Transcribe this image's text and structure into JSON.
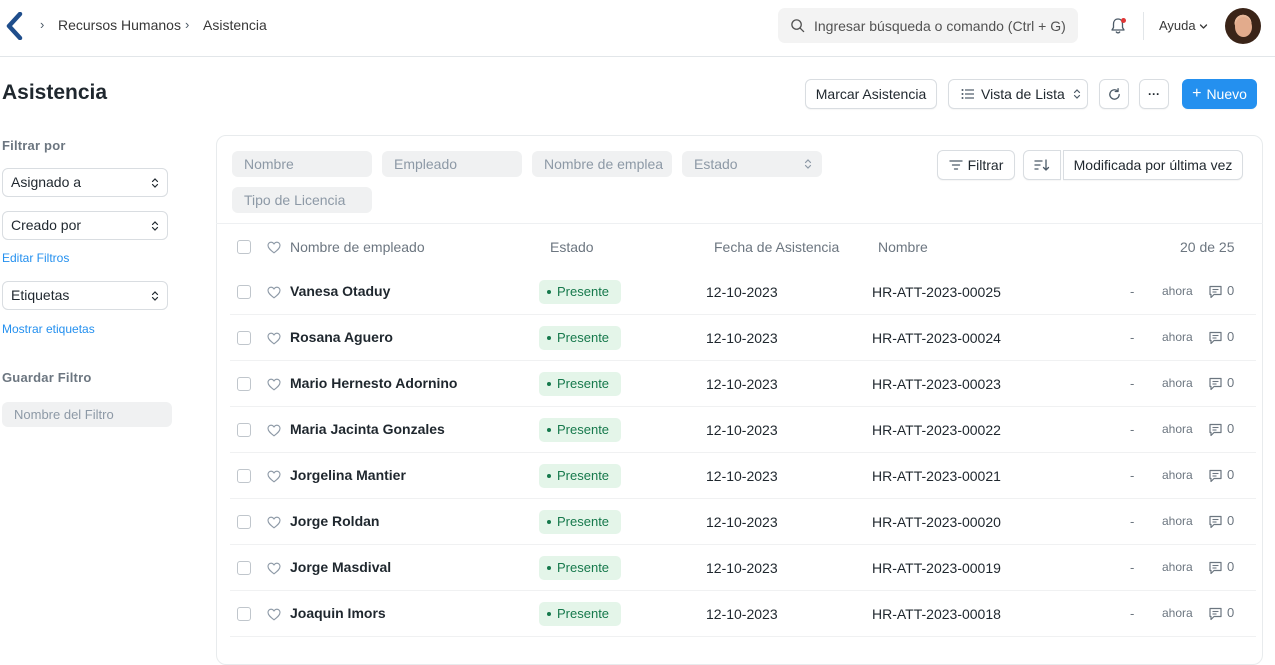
{
  "breadcrumb": {
    "module": "Recursos Humanos",
    "page": "Asistencia"
  },
  "search": {
    "placeholder": "Ingresar búsqueda o comando (Ctrl + G)"
  },
  "navbar": {
    "help_label": "Ayuda"
  },
  "page": {
    "title": "Asistencia"
  },
  "actions": {
    "mark_attendance": "Marcar Asistencia",
    "list_view": "Vista de Lista",
    "new_label": "Nuevo",
    "more": "···"
  },
  "sidebar": {
    "filter_by": "Filtrar por",
    "assigned_to": "Asignado a",
    "created_by": "Creado por",
    "edit_filters": "Editar Filtros",
    "tags": "Etiquetas",
    "show_tags": "Mostrar etiquetas",
    "save_filter": "Guardar Filtro",
    "filter_name_placeholder": "Nombre del Filtro"
  },
  "filters": {
    "name_placeholder": "Nombre",
    "employee_placeholder": "Empleado",
    "employee_name_placeholder": "Nombre de emplea",
    "status_placeholder": "Estado",
    "leave_type_placeholder": "Tipo de Licencia",
    "filter_button": "Filtrar",
    "sort_label": "Modificada por última vez"
  },
  "table": {
    "columns": {
      "employee_name": "Nombre de empleado",
      "status": "Estado",
      "date": "Fecha de Asistencia",
      "name": "Nombre"
    },
    "count": "20 de 25",
    "rows": [
      {
        "employee": "Vanesa Otaduy",
        "status": "Presente",
        "date": "12-10-2023",
        "name": "HR-ATT-2023-00025",
        "dash": "-",
        "modified": "ahora",
        "comments": "0"
      },
      {
        "employee": "Rosana Aguero",
        "status": "Presente",
        "date": "12-10-2023",
        "name": "HR-ATT-2023-00024",
        "dash": "-",
        "modified": "ahora",
        "comments": "0"
      },
      {
        "employee": "Mario Hernesto Adornino",
        "status": "Presente",
        "date": "12-10-2023",
        "name": "HR-ATT-2023-00023",
        "dash": "-",
        "modified": "ahora",
        "comments": "0"
      },
      {
        "employee": "Maria Jacinta Gonzales",
        "status": "Presente",
        "date": "12-10-2023",
        "name": "HR-ATT-2023-00022",
        "dash": "-",
        "modified": "ahora",
        "comments": "0"
      },
      {
        "employee": "Jorgelina Mantier",
        "status": "Presente",
        "date": "12-10-2023",
        "name": "HR-ATT-2023-00021",
        "dash": "-",
        "modified": "ahora",
        "comments": "0"
      },
      {
        "employee": "Jorge Roldan",
        "status": "Presente",
        "date": "12-10-2023",
        "name": "HR-ATT-2023-00020",
        "dash": "-",
        "modified": "ahora",
        "comments": "0"
      },
      {
        "employee": "Jorge Masdival",
        "status": "Presente",
        "date": "12-10-2023",
        "name": "HR-ATT-2023-00019",
        "dash": "-",
        "modified": "ahora",
        "comments": "0"
      },
      {
        "employee": "Joaquin Imors",
        "status": "Presente",
        "date": "12-10-2023",
        "name": "HR-ATT-2023-00018",
        "dash": "-",
        "modified": "ahora",
        "comments": "0"
      }
    ]
  },
  "colors": {
    "accent": "#2490ef",
    "status_bg": "#e4f5e9",
    "status_text": "#16794c"
  }
}
